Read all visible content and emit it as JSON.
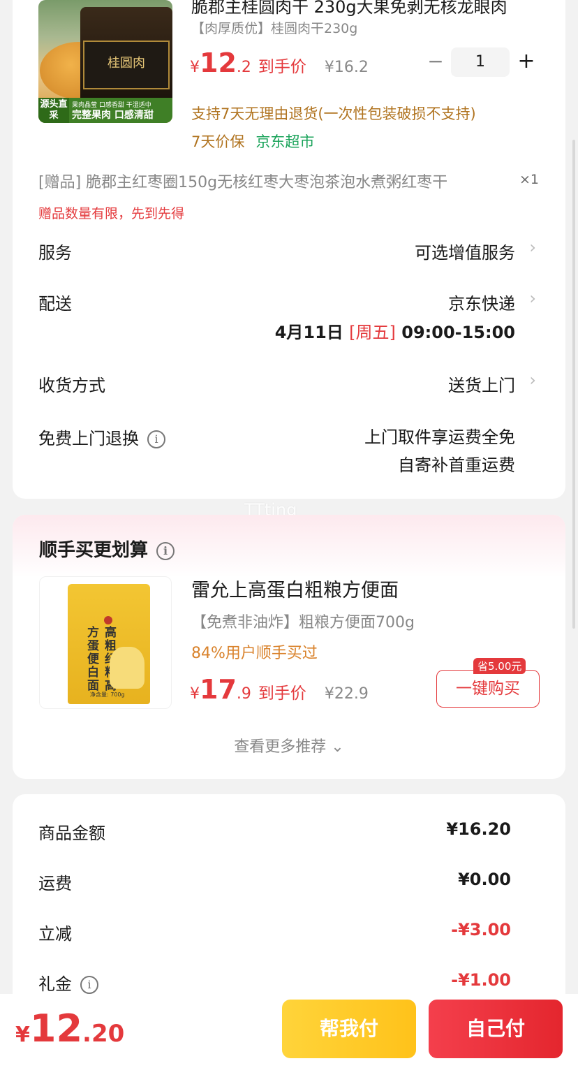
{
  "product": {
    "title": "脆郡主桂圆肉干 230g大果免剥无核龙眼肉",
    "subtitle": "【肉厚质优】桂圆肉干230g",
    "image_jar_label": "桂圆肉",
    "image_strip_left": "源头直采",
    "image_strip_top": "果肉晶莹 口感香甜 干湿适中",
    "image_strip_main": "完整果肉 口感清甜",
    "price_yen": "¥",
    "price_int": "12",
    "price_dec": ".2",
    "price_tag": "到手价",
    "original_price": "¥16.2",
    "quantity": "1",
    "minus_symbol": "−",
    "plus_symbol": "+",
    "policy": "支持7天无理由退货(一次性包装破损不支持)",
    "tag_price_protect": "7天价保",
    "tag_store": "京东超市"
  },
  "gift": {
    "text": "[赠品] 脆郡主红枣圈150g无核红枣大枣泡茶泡水煮粥红枣干",
    "qty": "×1",
    "note": "赠品数量有限，先到先得"
  },
  "rows": {
    "service_label": "服务",
    "service_value": "可选增值服务",
    "delivery_label": "配送",
    "delivery_value": "京东快递",
    "delivery_date": "4月11日",
    "delivery_weekday": "[周五]",
    "delivery_time": "09:00-15:00",
    "receive_label": "收货方式",
    "receive_value": "送货上门",
    "return_label": "免费上门退换",
    "return_value_1": "上门取件享运费全免",
    "return_value_2": "自寄补首重运费",
    "info_symbol": "i",
    "chevron": "›"
  },
  "watermark": "TTting",
  "recommend": {
    "title": "顺手买更划算",
    "product_title": "雷允上高蛋白粗粮方便面",
    "product_sub": "【免煮非油炸】粗粮方便面700g",
    "buyers": "84%用户顺手买过",
    "price_yen": "¥",
    "price_int": "17",
    "price_dec": ".9",
    "price_tag": "到手价",
    "original_price": "¥22.9",
    "buy_button": "一键购买",
    "save_badge": "省5.00元",
    "bag_text": "高粗纤粮高方蛋便白面",
    "bag_small": "净含量: 700g",
    "more": "查看更多推荐 ⌄"
  },
  "summary": {
    "goods_label": "商品金额",
    "goods_value": "¥16.20",
    "shipping_label": "运费",
    "shipping_value": "¥0.00",
    "discount_label": "立减",
    "discount_value": "-¥3.00",
    "gift_card_label": "礼金",
    "gift_card_value": "-¥1.00"
  },
  "bottom": {
    "yen": "¥",
    "total_int": "12",
    "total_dec": ".20",
    "help_pay": "帮我付",
    "self_pay": "自己付"
  }
}
